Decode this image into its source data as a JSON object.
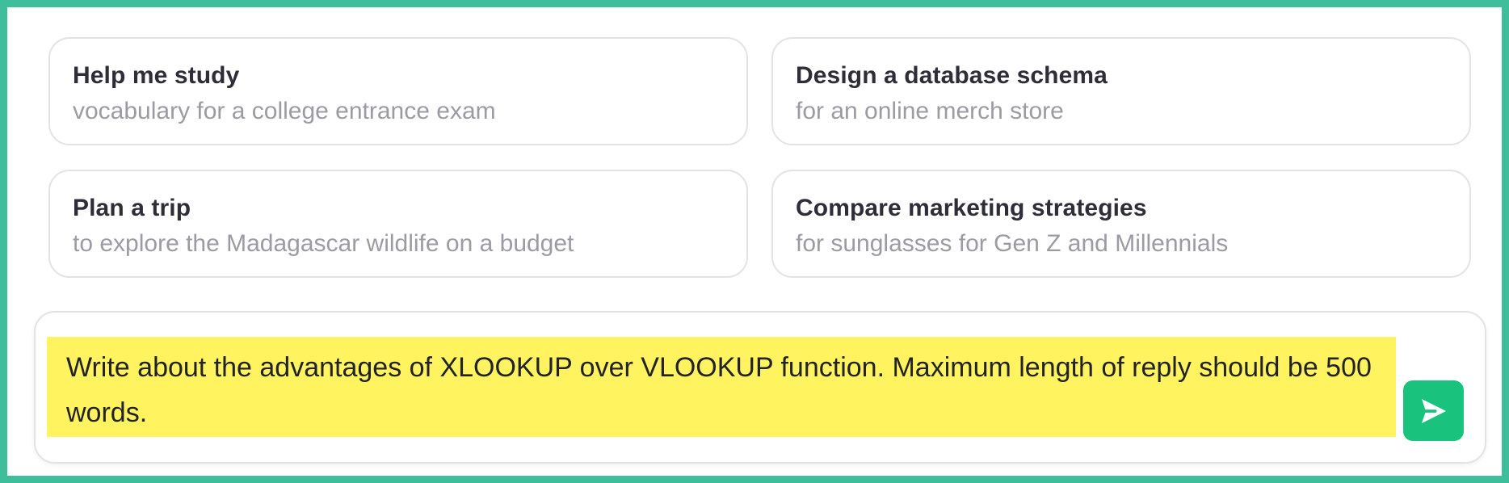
{
  "suggestions": [
    {
      "title": "Help me study",
      "subtitle": "vocabulary for a college entrance exam"
    },
    {
      "title": "Design a database schema",
      "subtitle": "for an online merch store"
    },
    {
      "title": "Plan a trip",
      "subtitle": "to explore the Madagascar wildlife on a budget"
    },
    {
      "title": "Compare marketing strategies",
      "subtitle": "for sunglasses for Gen Z and Millennials"
    }
  ],
  "composer": {
    "text": "Write about the advantages of XLOOKUP over VLOOKUP function. Maximum length of reply should be 500 words.",
    "send_icon": "send-icon"
  },
  "colors": {
    "frame_border": "#3fbe9b",
    "highlight": "#fff45f",
    "send_button": "#19c37d",
    "title_text": "#2e2e38",
    "subtitle_text": "#9b9ba3"
  }
}
